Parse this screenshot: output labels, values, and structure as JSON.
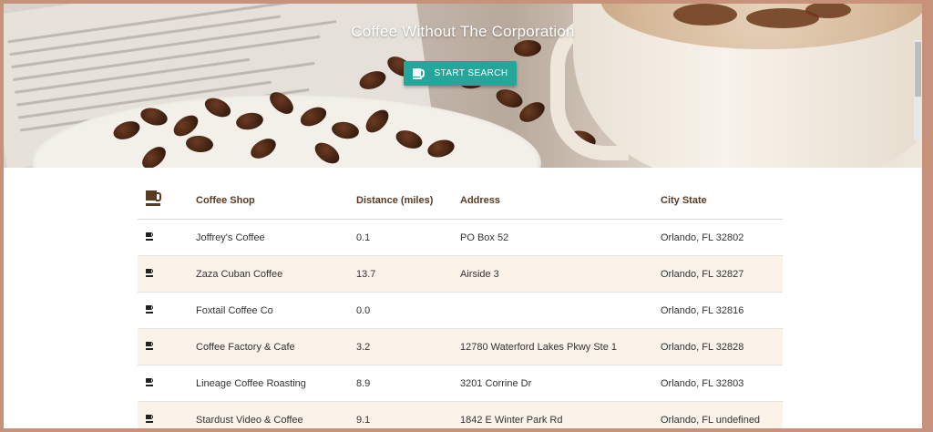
{
  "hero": {
    "title": "Coffee Without The Corporation",
    "search_button": "Start Search"
  },
  "table": {
    "headers": [
      "",
      "Coffee Shop",
      "Distance (miles)",
      "Address",
      "City State"
    ],
    "rows": [
      {
        "shop": "Joffrey's Coffee",
        "distance": "0.1",
        "address": "PO Box 52",
        "city": "Orlando, FL 32802"
      },
      {
        "shop": "Zaza Cuban Coffee",
        "distance": "13.7",
        "address": "Airside 3",
        "city": "Orlando, FL 32827"
      },
      {
        "shop": "Foxtail Coffee Co",
        "distance": "0.0",
        "address": "",
        "city": "Orlando, FL 32816"
      },
      {
        "shop": "Coffee Factory & Cafe",
        "distance": "3.2",
        "address": "12780 Waterford Lakes Pkwy Ste 1",
        "city": "Orlando, FL 32828"
      },
      {
        "shop": "Lineage Coffee Roasting",
        "distance": "8.9",
        "address": "3201 Corrine Dr",
        "city": "Orlando, FL 32803"
      },
      {
        "shop": "Stardust Video & Coffee",
        "distance": "9.1",
        "address": "1842 E Winter Park Rd",
        "city": "Orlando, FL undefined"
      }
    ]
  },
  "colors": {
    "accent": "#26a69a",
    "header_text": "#5a3a22",
    "alt_row": "#fbf3ea",
    "frame": "#c8917a"
  },
  "icons": {
    "header": "coffee-cup-icon",
    "row": "coffee-cup-icon",
    "button": "coffee-cup-icon"
  }
}
